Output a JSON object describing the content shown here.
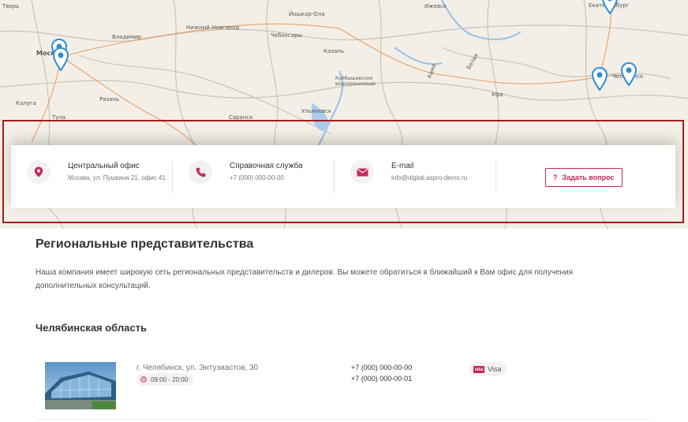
{
  "map": {
    "cities": [
      {
        "name": "Тверь"
      },
      {
        "name": "Ижевск"
      },
      {
        "name": "Екатеринбург"
      },
      {
        "name": "Йошкар-Ола"
      },
      {
        "name": "Нижний Новгород"
      },
      {
        "name": "Владимир"
      },
      {
        "name": "Чебоксары"
      },
      {
        "name": "Москва"
      },
      {
        "name": "Казань"
      },
      {
        "name": "Куйбышевское водохранилище"
      },
      {
        "name": "Калуга"
      },
      {
        "name": "Рязань"
      },
      {
        "name": "Тула"
      },
      {
        "name": "Саранск"
      },
      {
        "name": "Ульяновск"
      },
      {
        "name": "Уфа"
      },
      {
        "name": "Челябинск"
      },
      {
        "name": "Белая"
      },
      {
        "name": "Кама"
      }
    ]
  },
  "contacts": {
    "office": {
      "title": "Центральный офис",
      "subtitle": "Москва, ул. Пушкина 21, офис 41"
    },
    "help": {
      "title": "Справочная служба",
      "subtitle": "+7 (000) 000-00-00"
    },
    "email": {
      "title": "E-mail",
      "subtitle": "info@digital.aspro-demo.ru"
    },
    "ask_button": {
      "icon": "?",
      "label": "Задать вопрос"
    }
  },
  "content": {
    "title": "Региональные представительства",
    "description": "Наша компания имеет широкую сеть региональных представительств и дилеров. Вы можете обратиться в ближайший к Вам офис для получения дополнительных консультаций.",
    "region": "Челябинская область",
    "offices": [
      {
        "address": "г. Челябинск, ул. Энтузиастов, 30",
        "hours": "09:00 - 20:00",
        "phones": [
          "+7 (000) 000-00-00",
          "+7 (000) 000-00-01"
        ],
        "payment": "Visa",
        "payment_mark": "VISA"
      }
    ]
  },
  "colors": {
    "accent": "#c8265a",
    "highlight": "#a51c1c",
    "pin": "#2b8fd8"
  }
}
